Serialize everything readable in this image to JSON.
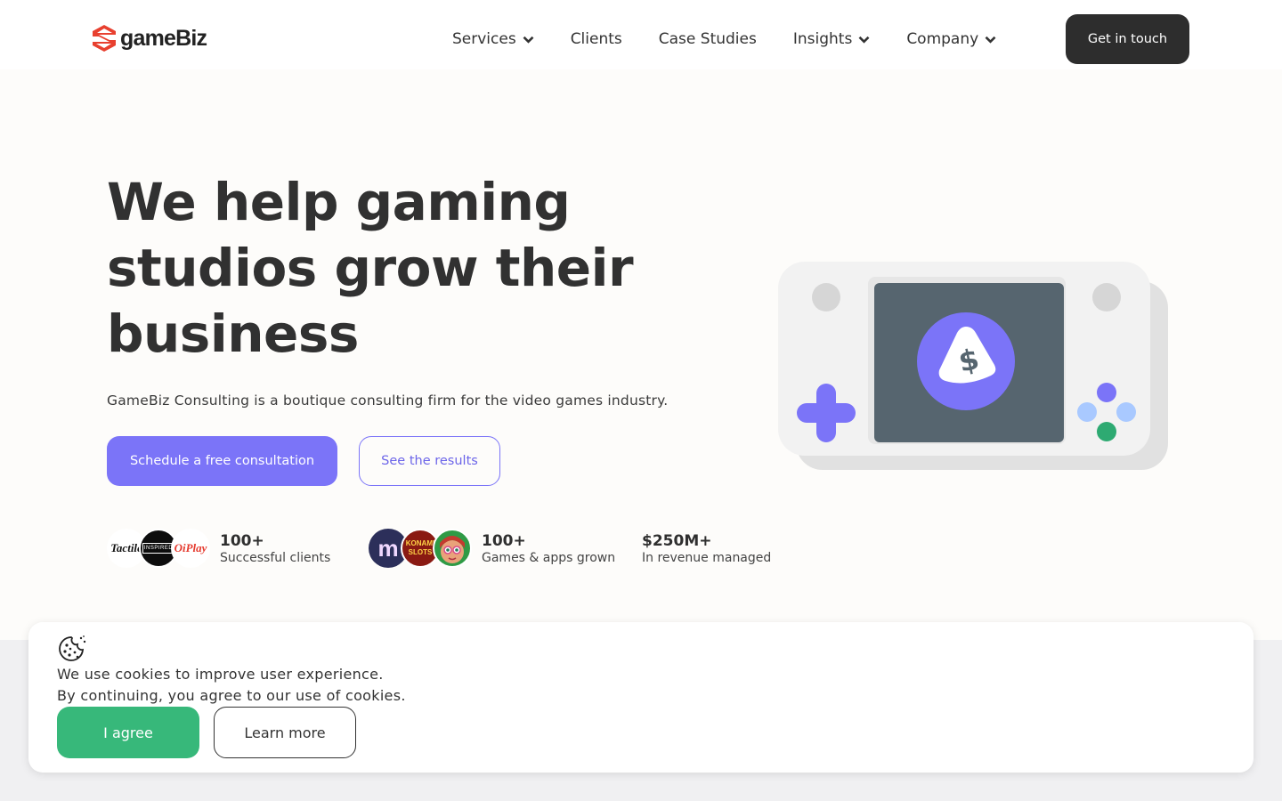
{
  "brand": {
    "name": "gameBiz"
  },
  "nav": {
    "items": [
      {
        "label": "Services",
        "dropdown": true
      },
      {
        "label": "Clients",
        "dropdown": false
      },
      {
        "label": "Case Studies",
        "dropdown": false
      },
      {
        "label": "Insights",
        "dropdown": true
      },
      {
        "label": "Company",
        "dropdown": true
      }
    ],
    "cta_label": "Get in touch"
  },
  "hero": {
    "title": "We help gaming studios grow their business",
    "subtitle": "GameBiz Consulting is a boutique consulting firm for the video games industry.",
    "primary_button": "Schedule a free consultation",
    "secondary_button": "See the results"
  },
  "stats": [
    {
      "value": "100+",
      "label": "Successful clients",
      "avatars": [
        "Tactile",
        "INSPIRED",
        "OiPlay"
      ]
    },
    {
      "value": "100+",
      "label": "Games & apps grown",
      "avatars": [
        "m",
        "KONAMI SLOTS",
        "character-avatar"
      ]
    },
    {
      "value": "$250M+",
      "label": "In revenue managed"
    }
  ],
  "illustration": {
    "icon": "game-console-dollar-icon",
    "symbol": "$"
  },
  "cookie": {
    "icon": "cookie-icon",
    "line1": "We use cookies to improve user experience.",
    "line2": "By continuing, you agree to our use of cookies.",
    "agree": "I agree",
    "learn_more": "Learn more"
  },
  "colors": {
    "primary": "#7b74f8",
    "dark": "#2d2d2d",
    "agree": "#37b87a",
    "brand_red": "#e8402f",
    "screen": "#56656f"
  }
}
